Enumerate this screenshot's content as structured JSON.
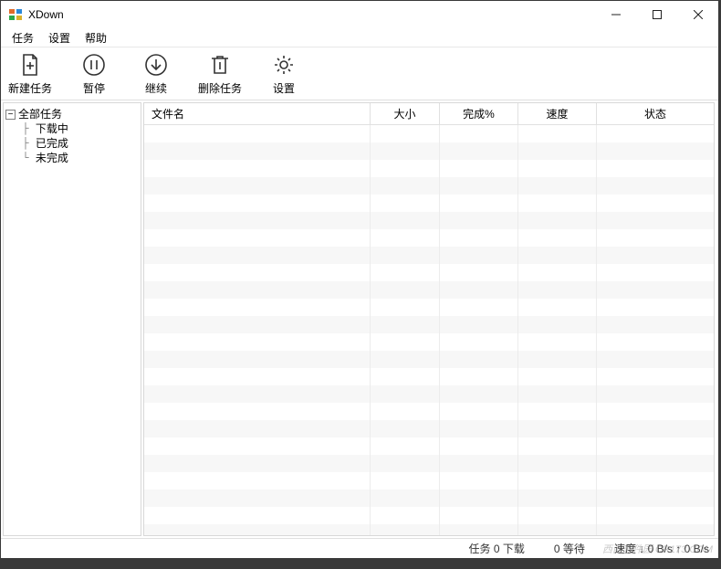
{
  "app": {
    "title": "XDown"
  },
  "menu": {
    "items": [
      "任务",
      "设置",
      "帮助"
    ]
  },
  "toolbar": {
    "new_task": "新建任务",
    "pause": "暂停",
    "resume": "继续",
    "delete": "删除任务",
    "settings": "设置"
  },
  "tree": {
    "root": "全部任务",
    "children": [
      "下载中",
      "已完成",
      "未完成"
    ]
  },
  "columns": [
    "文件名",
    "大小",
    "完成%",
    "速度",
    "状态"
  ],
  "status": {
    "tasks_label": "任务",
    "tasks_count": "0",
    "download_label": "下载",
    "waiting_count": "0",
    "waiting_label": "等待",
    "speed_label": "速度",
    "speed_value": "↓ 0 B/s ↑ 0 B/s"
  },
  "watermark": "西西软件园 CR173.COM"
}
